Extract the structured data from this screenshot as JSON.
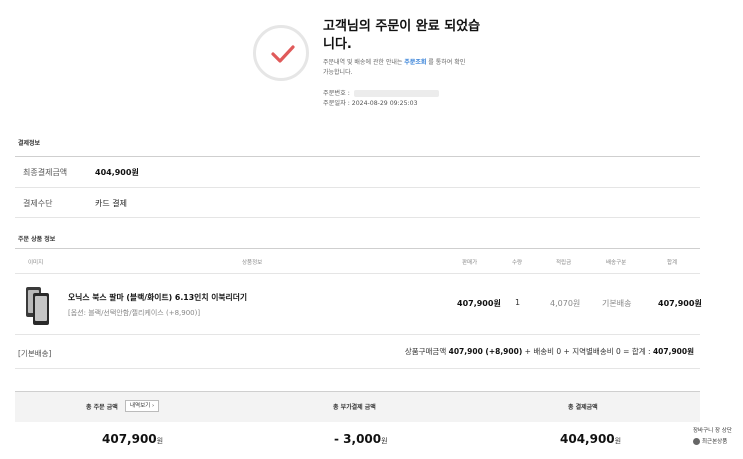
{
  "completion": {
    "title": "고객님의 주문이 완료 되었습니다.",
    "desc_before": "주문내역 및 배송에 관한 안내는 ",
    "desc_link": "주문조회",
    "desc_after": " 를 통하여 확인 가능합니다.",
    "order_no_label": "주문번호 :",
    "order_date": "주문일자 : 2024-08-29 09:25:03"
  },
  "payment": {
    "section_label": "결제정보",
    "final_amount_label": "최종결제금액",
    "final_amount": "404,900원",
    "method_label": "결제수단",
    "method": "카드 결제"
  },
  "products": {
    "section_label": "주문 상품 정보",
    "headers": {
      "image": "이미지",
      "info": "상품정보",
      "price": "판매가",
      "qty": "수량",
      "points": "적립금",
      "ship_type": "배송구분",
      "total": "합계"
    },
    "items": [
      {
        "name": "오닉스 북스 팔마 (블랙/화이트) 6.13인치 이북리더기",
        "option": "[옵션: 블랙/선택안함/젤리케이스 (+8,900)]",
        "price": "407,900원",
        "qty": "1",
        "points": "4,070원",
        "ship_type": "기본배송",
        "total": "407,900원"
      }
    ],
    "ship_group": "[기본배송]",
    "summary_pre": "상품구매금액 ",
    "summary_amount": "407,900 (+8,900)",
    "summary_mid": " + 배송비 0 + 지역별배송비 0 = 합계 : ",
    "summary_total": "407,900원"
  },
  "totals": {
    "order_label": "총 주문 금액",
    "detail_button": "내역보기 ›",
    "extra_label": "총 부가결제 금액",
    "pay_label": "총 결제금액",
    "order_value": "407,900",
    "extra_value": "- 3,000",
    "pay_value": "404,900",
    "currency": "원"
  },
  "float_menu": {
    "line1": "장바구니 장 상단",
    "line2": "최근본상품"
  },
  "colors": {
    "check": "#e05a5a",
    "link": "#2a7ad6"
  }
}
